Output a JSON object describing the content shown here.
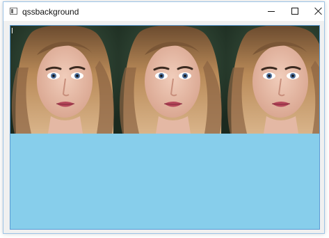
{
  "window": {
    "title": "qssbackground",
    "icon": "app-window-icon",
    "controls": {
      "minimize": "minimize-icon",
      "maximize": "maximize-icon",
      "close": "close-icon"
    }
  },
  "widget": {
    "background_color": "#87ceeb",
    "border_color": "#5a9bd5",
    "background_image": {
      "description_icon": "portrait-photo-tile",
      "repeat": "repeat-x",
      "tile_count": 3
    }
  }
}
